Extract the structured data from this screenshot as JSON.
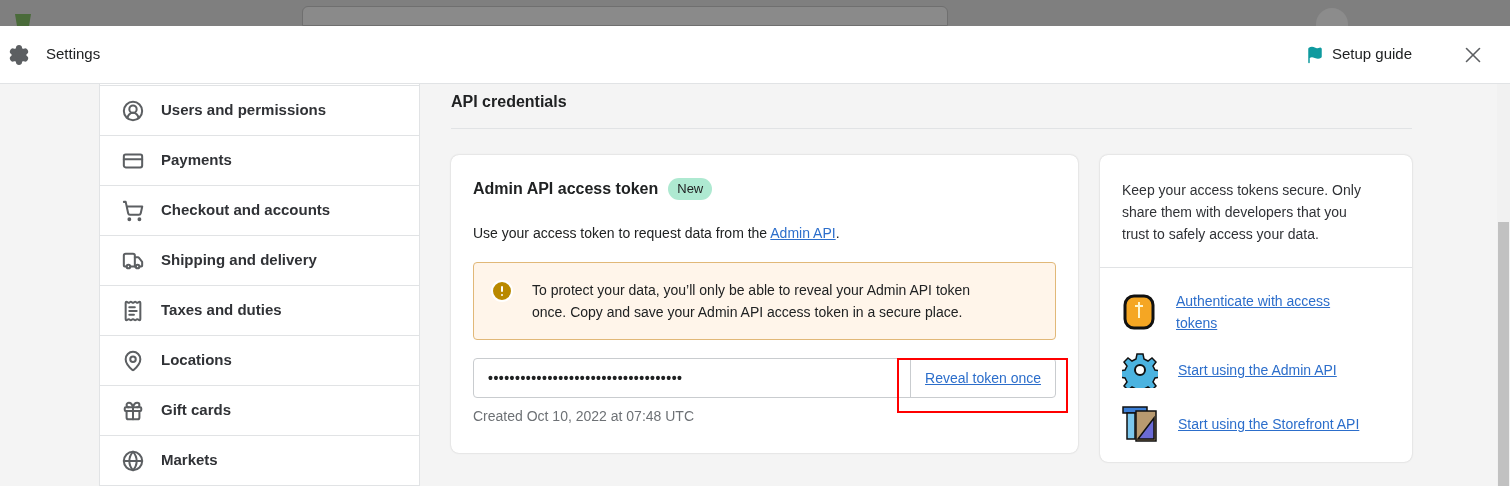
{
  "modal": {
    "title": "Settings",
    "setup_guide": "Setup guide"
  },
  "sidebar": {
    "items": [
      {
        "label": "Users and permissions",
        "kind": "user"
      },
      {
        "label": "Payments",
        "kind": "payment"
      },
      {
        "label": "Checkout and accounts",
        "kind": "cart"
      },
      {
        "label": "Shipping and delivery",
        "kind": "truck"
      },
      {
        "label": "Taxes and duties",
        "kind": "tax"
      },
      {
        "label": "Locations",
        "kind": "pin"
      },
      {
        "label": "Gift cards",
        "kind": "gift"
      },
      {
        "label": "Markets",
        "kind": "globe"
      }
    ]
  },
  "section_title": "API credentials",
  "token_card": {
    "title": "Admin API access token",
    "badge": "New",
    "description_before": "Use your access token to request data from the ",
    "description_link": "Admin API",
    "description_after": ".",
    "warning": "To protect your data, you’ll only be able to reveal your Admin API token once. Copy and save your Admin API access token in a secure place.",
    "token_value": "••••••••••••••••••••••••••••••••••••",
    "reveal_button": "Reveal token once",
    "created": "Created Oct 10, 2022 at 07:48 UTC"
  },
  "info_card": {
    "text": "Keep your access tokens secure. Only share them with developers that you trust to safely access your data.",
    "links": [
      {
        "label": "Authenticate with access tokens",
        "kind": "coin"
      },
      {
        "label": "Start using the Admin API",
        "kind": "gear"
      },
      {
        "label": "Start using the Storefront API",
        "kind": "ruler"
      }
    ]
  }
}
